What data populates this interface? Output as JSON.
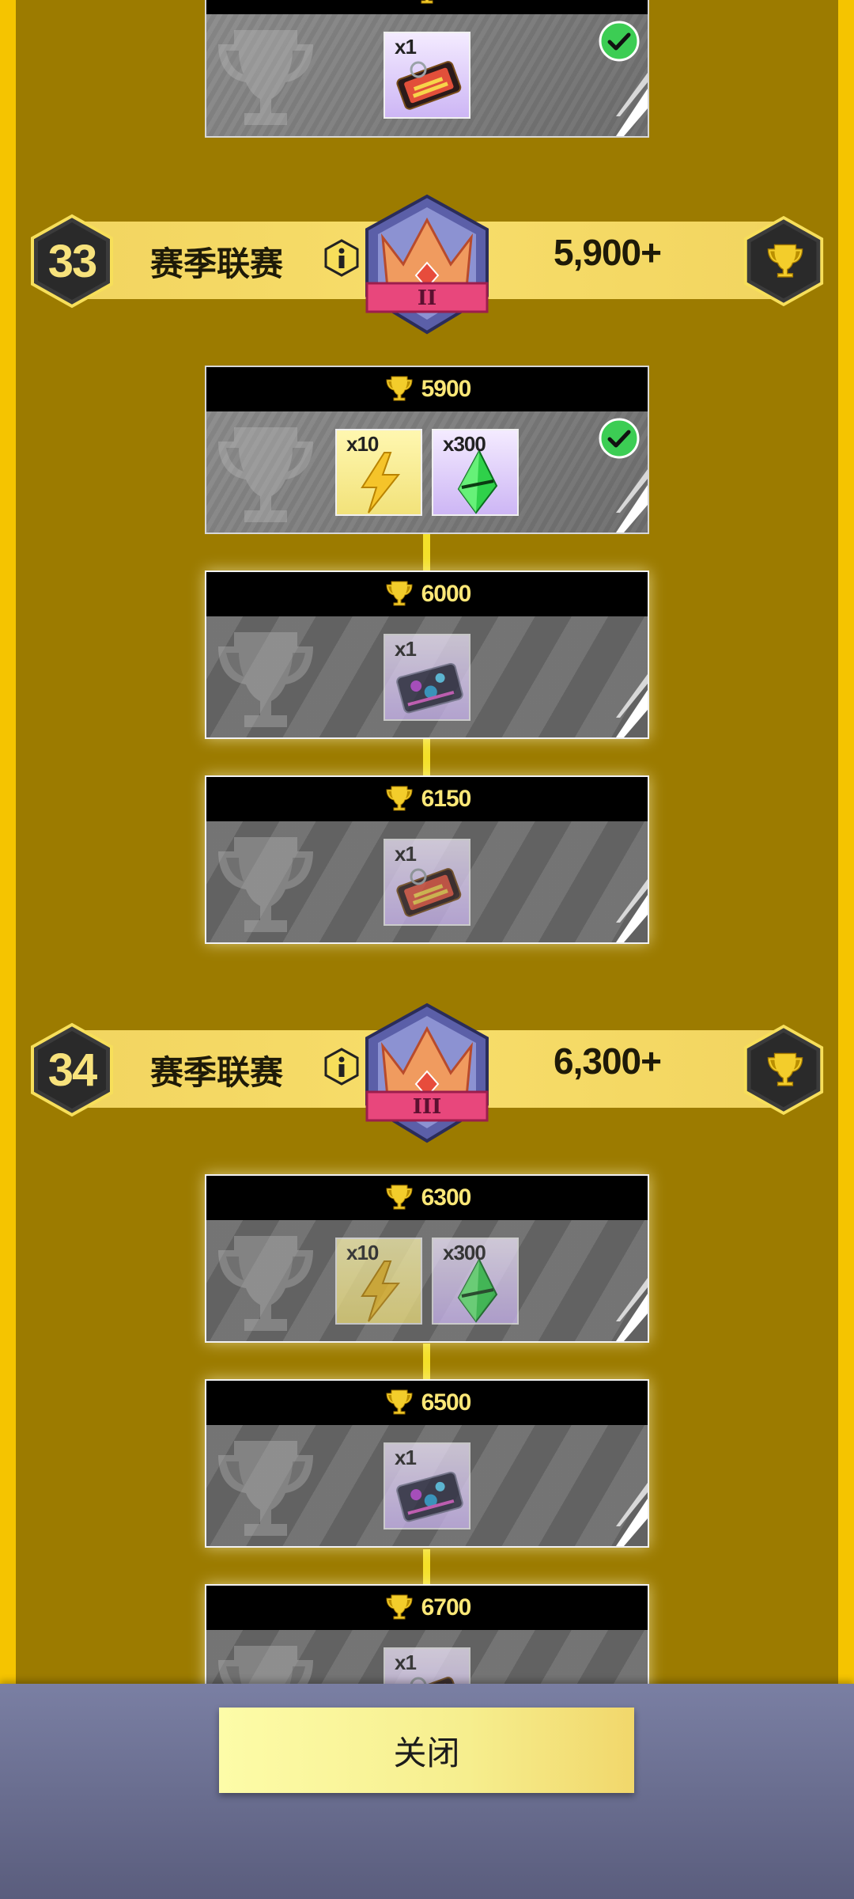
{
  "colors": {
    "background": "#9c7b00",
    "side_bar": "#f5c400",
    "banner": "#f7dd6a",
    "header": "#000000",
    "score_text": "#fbe777",
    "check": "#3ccd54",
    "close_button": "#f6ee8e"
  },
  "top_partial_card": {
    "claimed": true,
    "items": [
      {
        "qty": "x1",
        "icon": "fire-ticket-icon",
        "tint": "purple"
      }
    ]
  },
  "leagues": [
    {
      "level": "33",
      "name": "赛季联赛",
      "rank_numeral": "II",
      "threshold": "5,900+",
      "icon": "crown-badge-icon"
    },
    {
      "level": "34",
      "name": "赛季联赛",
      "rank_numeral": "III",
      "threshold": "6,300+",
      "icon": "crown-badge-icon"
    }
  ],
  "rewards": [
    {
      "score": "5900",
      "claimed": true,
      "items": [
        {
          "qty": "x10",
          "icon": "lightning-icon",
          "tint": "yellow"
        },
        {
          "qty": "x300",
          "icon": "green-gem-icon",
          "tint": "purple"
        }
      ]
    },
    {
      "score": "6000",
      "claimed": false,
      "items": [
        {
          "qty": "x1",
          "icon": "circuit-card-icon",
          "tint": "purple"
        }
      ]
    },
    {
      "score": "6150",
      "claimed": false,
      "items": [
        {
          "qty": "x1",
          "icon": "fire-ticket-icon",
          "tint": "purple"
        }
      ]
    },
    {
      "score": "6300",
      "claimed": false,
      "items": [
        {
          "qty": "x10",
          "icon": "lightning-icon",
          "tint": "yellow"
        },
        {
          "qty": "x300",
          "icon": "green-gem-icon",
          "tint": "purple"
        }
      ]
    },
    {
      "score": "6500",
      "claimed": false,
      "items": [
        {
          "qty": "x1",
          "icon": "circuit-card-icon",
          "tint": "purple"
        }
      ]
    },
    {
      "score": "6700",
      "claimed": false,
      "items": [
        {
          "qty": "x1",
          "icon": "fire-ticket-icon",
          "tint": "purple"
        }
      ]
    }
  ],
  "footer": {
    "close_label": "关闭"
  }
}
